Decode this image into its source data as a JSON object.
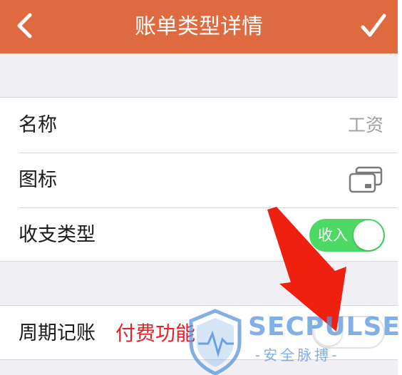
{
  "header": {
    "title": "账单类型详情",
    "back_icon": "chevron-left-icon",
    "confirm_icon": "checkmark-icon",
    "background_color": "#e06a40"
  },
  "form": {
    "rows": [
      {
        "label": "名称",
        "value": "工资"
      },
      {
        "label": "图标",
        "icon": "card-icon"
      },
      {
        "label": "收支类型",
        "toggle_text": "收入",
        "toggle_on": true,
        "toggle_color": "#4cd964"
      }
    ],
    "recurring": {
      "label": "周期记账",
      "badge": "付费功能",
      "badge_color": "#e8202a",
      "toggle_on": false
    }
  },
  "annotation": {
    "icon": "red-arrow-icon",
    "color": "#f02010"
  },
  "watermark": {
    "text": "SECPULSE",
    "subtext": "-安全脉搏-",
    "icon": "shield-logo-icon",
    "color": "#5696dc"
  }
}
